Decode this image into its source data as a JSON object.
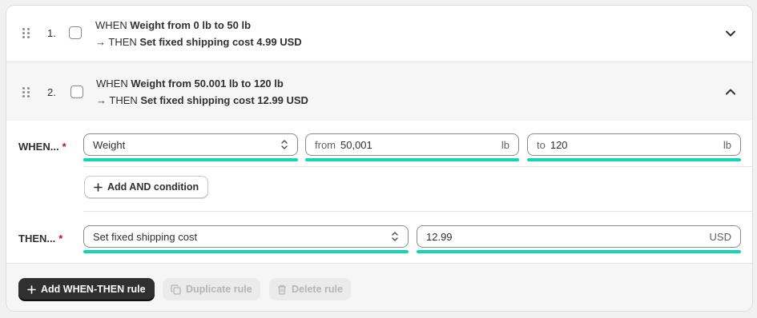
{
  "rules": [
    {
      "number": "1.",
      "when_prefix": "WHEN",
      "when_condition": "Weight from 0 lb to 50 lb",
      "then_prefix": "→ THEN",
      "then_action": "Set fixed shipping cost 4.99 USD",
      "expanded": false
    },
    {
      "number": "2.",
      "when_prefix": "WHEN",
      "when_condition": "Weight from 50.001 lb to 120 lb",
      "then_prefix": "→ THEN",
      "then_action": "Set fixed shipping cost 12.99 USD",
      "expanded": true
    }
  ],
  "editor": {
    "when_label": "WHEN...",
    "then_label": "THEN...",
    "required_mark": "*",
    "condition_select": "Weight",
    "from_prefix": "from",
    "from_value": "50,001",
    "from_unit": "lb",
    "to_prefix": "to",
    "to_value": "120",
    "to_unit": "lb",
    "add_and_label": "Add AND condition",
    "action_select": "Set fixed shipping cost",
    "cost_value": "12.99",
    "cost_unit": "USD"
  },
  "footer": {
    "add_rule_label": "Add WHEN-THEN rule",
    "duplicate_label": "Duplicate rule",
    "delete_label": "Delete rule"
  },
  "colors": {
    "highlight": "#10d7b3",
    "required": "#c70a24",
    "primary_button": "#303030"
  }
}
